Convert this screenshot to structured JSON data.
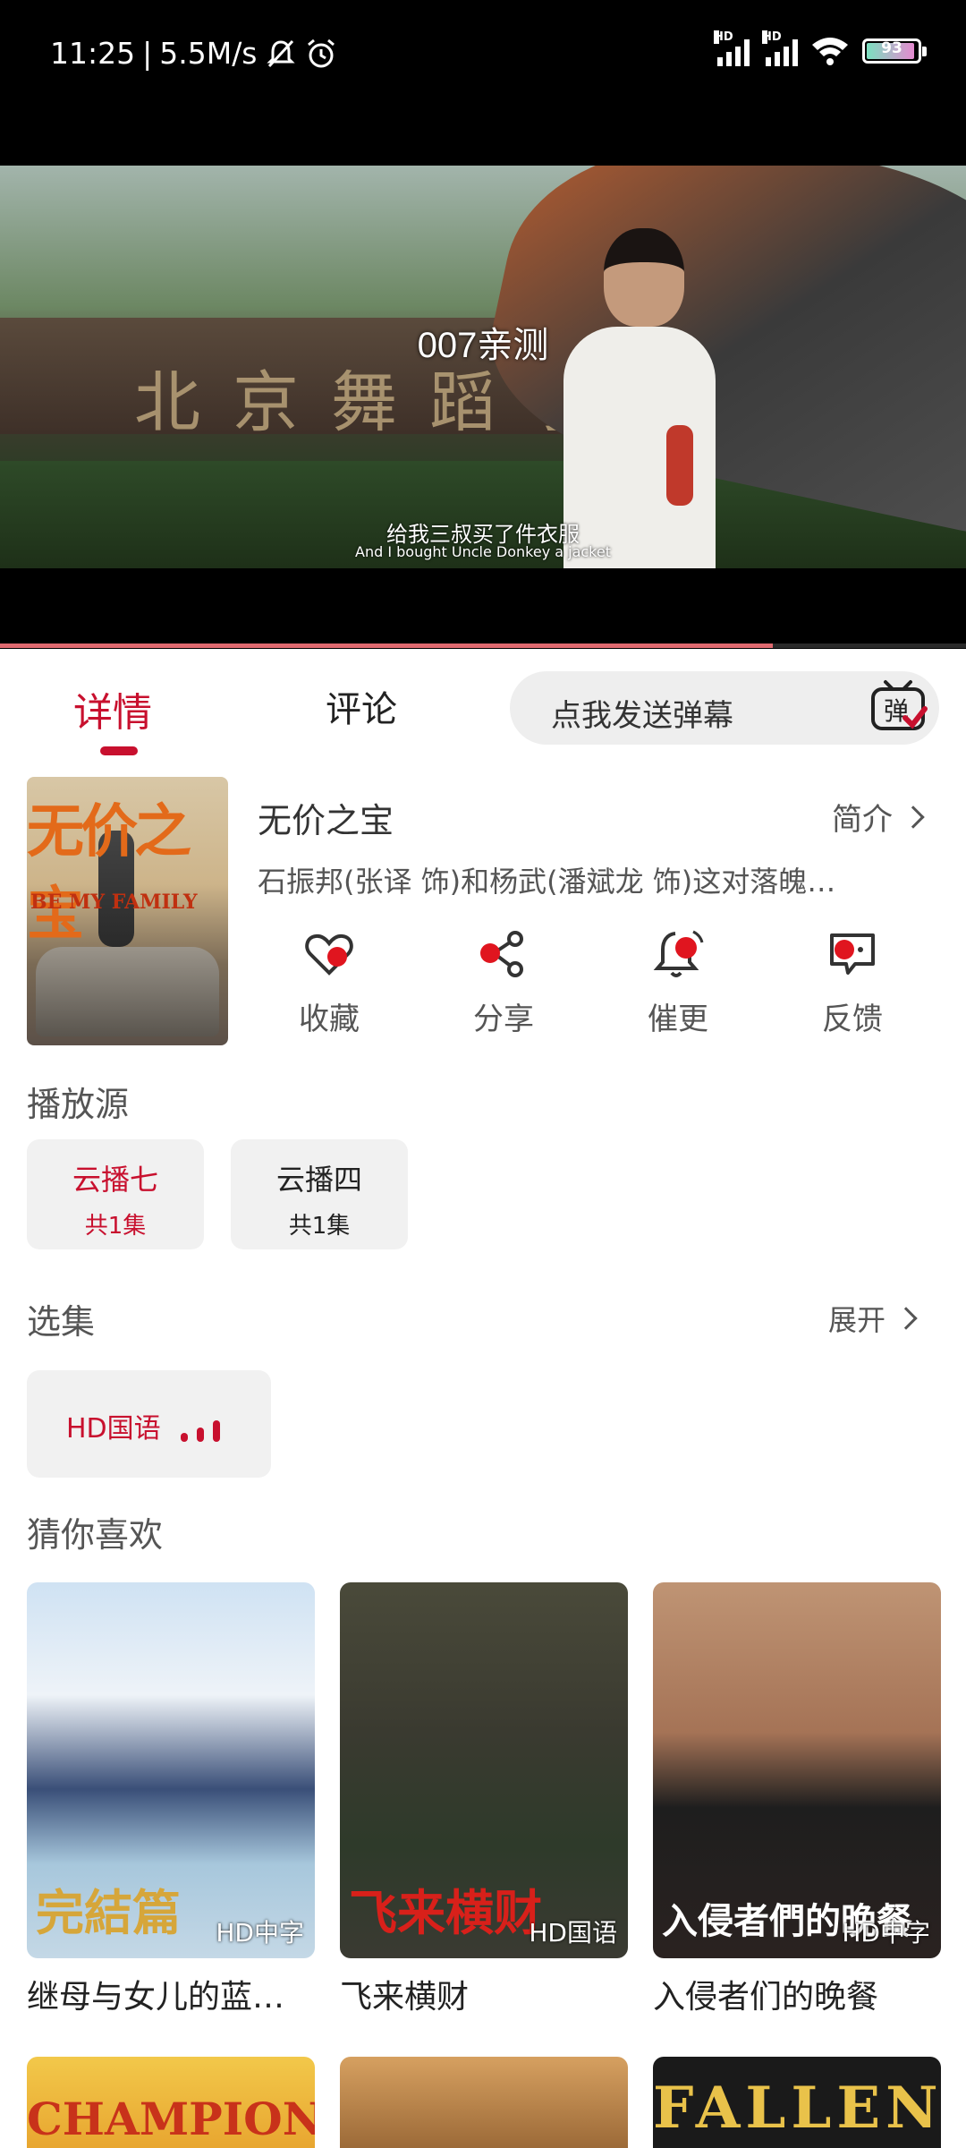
{
  "status_bar": {
    "time": "11:25",
    "speed": "5.5M/s",
    "battery": "93",
    "icons": [
      "mute-bell-icon",
      "alarm-icon",
      "signal-hd-icon",
      "signal-hd-icon",
      "wifi-icon",
      "battery-icon"
    ]
  },
  "player": {
    "watermark_title": "007亲测",
    "subtitle_cn": "给我三叔买了件衣服",
    "subtitle_en": "And I bought Uncle Donkey a jacket",
    "wall_text": "北京舞蹈学院",
    "progress": 0.8
  },
  "tabs": {
    "details": "详情",
    "comments": "评论",
    "danmu_placeholder": "点我发送弹幕",
    "danmu_icon_char": "弹"
  },
  "movie": {
    "title": "无价之宝",
    "synopsis_label": "简介",
    "description": "石振邦(张译 饰)和杨武(潘斌龙 饰)这对落魄…",
    "poster_title": "无价之宝",
    "poster_en": "BE MY FAMILY"
  },
  "actions": [
    {
      "label": "收藏",
      "icon": "favorite-heart-icon"
    },
    {
      "label": "分享",
      "icon": "share-icon"
    },
    {
      "label": "催更",
      "icon": "bell-icon"
    },
    {
      "label": "反馈",
      "icon": "feedback-icon"
    }
  ],
  "sources": {
    "title": "播放源",
    "items": [
      {
        "name": "云播七",
        "count": "共1集",
        "selected": true
      },
      {
        "name": "云播四",
        "count": "共1集",
        "selected": false
      }
    ]
  },
  "episodes": {
    "title": "选集",
    "expand_label": "展开",
    "items": [
      {
        "label": "HD国语",
        "playing": true
      }
    ]
  },
  "recommend": {
    "title": "猜你喜欢",
    "items": [
      {
        "title": "继母与女儿的蓝…",
        "badge": "HD中字",
        "art_text": "完結篇"
      },
      {
        "title": "飞来横财",
        "badge": "HD国语",
        "art_text": "飞来横财"
      },
      {
        "title": "入侵者们的晚餐",
        "badge": "HD中字",
        "art_text": "入侵者們的晚餐"
      }
    ],
    "row2": [
      "CHAMPIONS",
      "",
      "FALLEN"
    ]
  },
  "colors": {
    "accent": "#c8102e",
    "progress": "#e06a70",
    "chip_bg": "#f1f1f1"
  }
}
